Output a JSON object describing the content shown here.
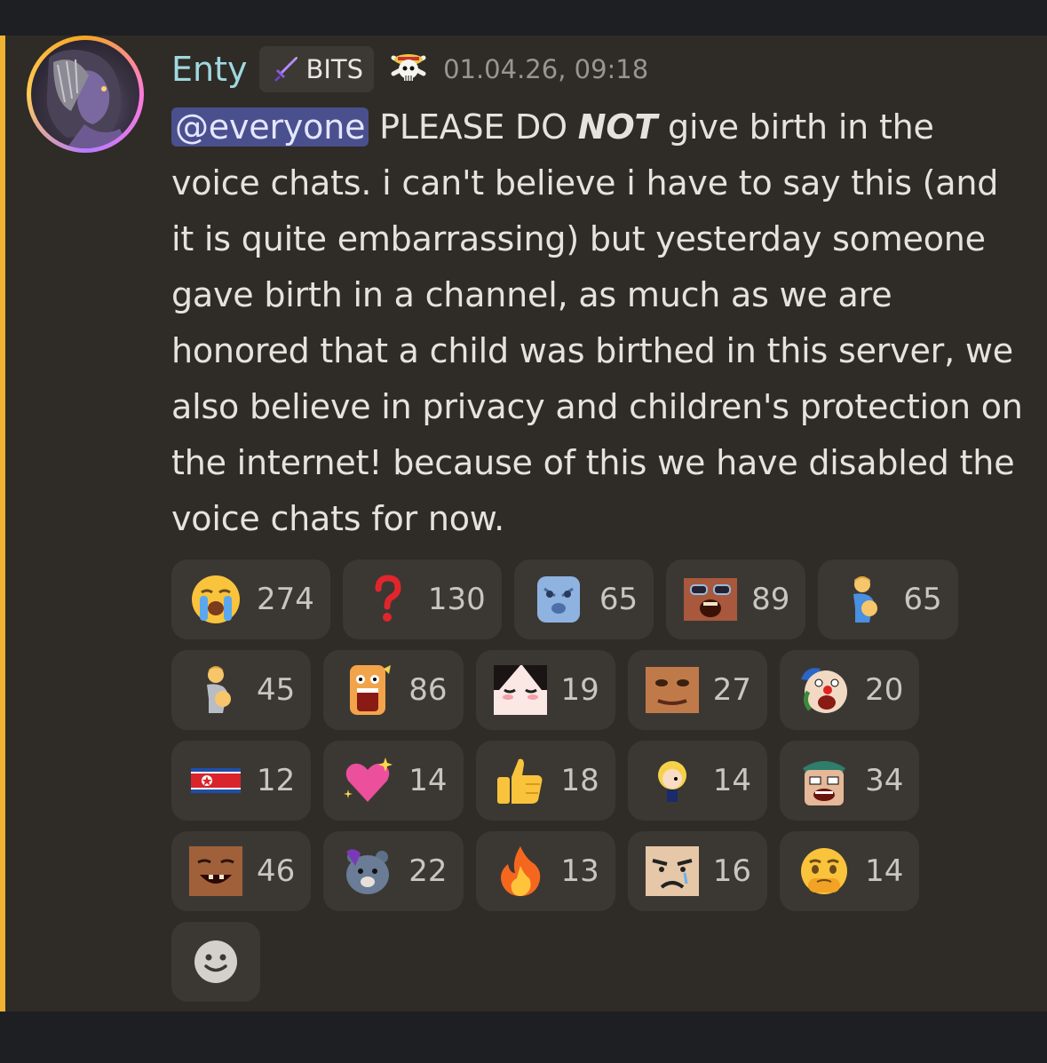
{
  "message": {
    "author": "Enty",
    "tag_label": "BITS",
    "tag_icon": "sword-icon",
    "role_icon": "straw-hat-jolly-roger-icon",
    "timestamp": "01.04.26, 09:18",
    "mention": "@everyone",
    "text_before_bold": " PLEASE DO ",
    "bold_text": "NOT",
    "text_after_bold": " give birth in the voice chats. i can't believe i have to say this (and it is quite embarrassing) but yesterday someone gave birth in a channel, as much as we are honored that a child was birthed in this server, we also believe in privacy and children's protection on the internet! because of this we have disabled the voice chats for now.",
    "colors": {
      "mention_bar": "#f0b232",
      "username": "#9fd8e0",
      "mention_bg": "#4a4f8e"
    }
  },
  "reactions": [
    [
      {
        "emoji": "loudly-crying-face-emoji",
        "count": "274"
      },
      {
        "emoji": "red-question-mark-emoji",
        "count": "130"
      },
      {
        "emoji": "blue-mask-face-emoji",
        "count": "65"
      },
      {
        "emoji": "sunglasses-screaming-face-emoji",
        "count": "89"
      },
      {
        "emoji": "pregnant-man-emoji",
        "count": "65"
      }
    ],
    [
      {
        "emoji": "pregnant-person-emoji",
        "count": "45"
      },
      {
        "emoji": "anime-screaming-emoji",
        "count": "86"
      },
      {
        "emoji": "blushing-anime-face-emoji",
        "count": "19"
      },
      {
        "emoji": "squished-face-emoji",
        "count": "27"
      },
      {
        "emoji": "clown-pirate-yelling-emoji",
        "count": "20"
      }
    ],
    [
      {
        "emoji": "north-korea-flag-emoji",
        "count": "12"
      },
      {
        "emoji": "sparkling-heart-emoji",
        "count": "14"
      },
      {
        "emoji": "thumbs-up-emoji",
        "count": "18"
      },
      {
        "emoji": "chibi-blonde-character-emoji",
        "count": "14"
      },
      {
        "emoji": "pirate-crying-emoji",
        "count": "34"
      }
    ],
    [
      {
        "emoji": "laughing-man-emoji",
        "count": "46"
      },
      {
        "emoji": "bear-with-blue-hair-emoji",
        "count": "22"
      },
      {
        "emoji": "fire-emoji",
        "count": "13"
      },
      {
        "emoji": "crying-manga-face-emoji",
        "count": "16"
      },
      {
        "emoji": "face-holding-back-tears-emoji",
        "count": "14"
      }
    ]
  ],
  "add_reaction_icon": "smiley-add-reaction-icon"
}
